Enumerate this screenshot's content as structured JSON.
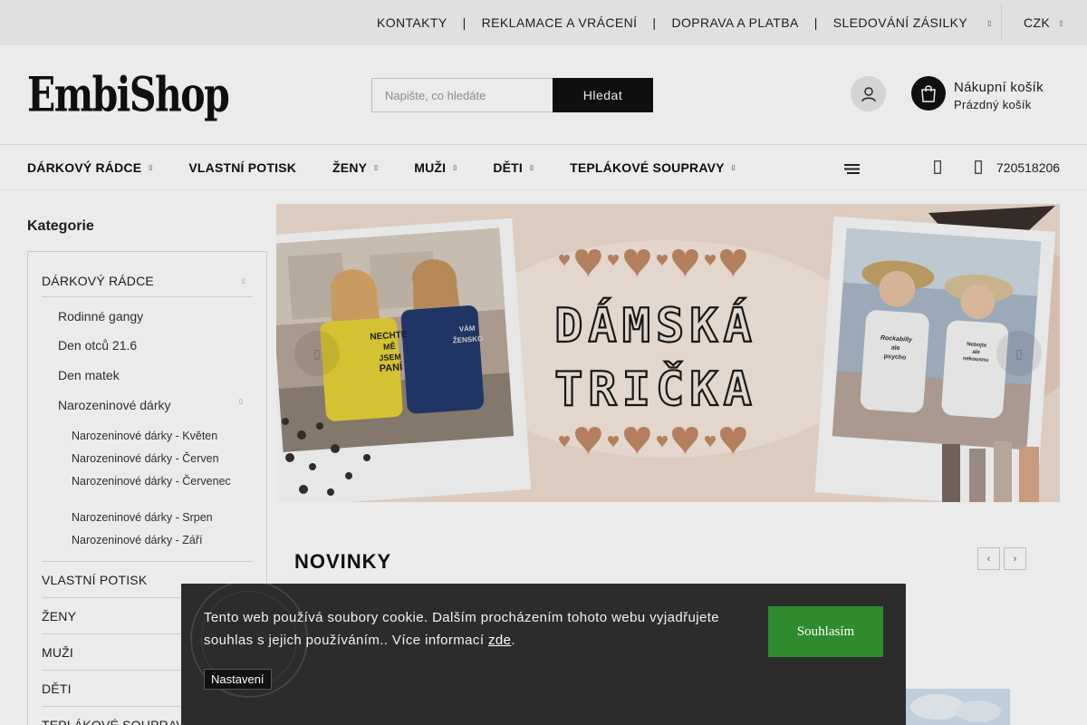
{
  "topbar": {
    "links": [
      "KONTAKTY",
      "REKLAMACE A VRÁCENÍ",
      "DOPRAVA A PLATBA",
      "SLEDOVÁNÍ ZÁSILKY"
    ],
    "separator": "|",
    "currency": "CZK"
  },
  "header": {
    "logo": "EmbiShop",
    "search_placeholder": "Napište, co hledáte",
    "search_button": "Hledat",
    "cart_title": "Nákupní košík",
    "cart_status": "Prázdný košík"
  },
  "nav": {
    "items": [
      {
        "label": "DÁRKOVÝ RÁDCE",
        "has_sub": true
      },
      {
        "label": "VLASTNÍ POTISK",
        "has_sub": false
      },
      {
        "label": "ŽENY",
        "has_sub": true
      },
      {
        "label": "MUŽI",
        "has_sub": true
      },
      {
        "label": "DĚTI",
        "has_sub": true
      },
      {
        "label": "TEPLÁKOVÉ SOUPRAVY",
        "has_sub": true
      }
    ],
    "phone": "720518206"
  },
  "sidebar": {
    "title": "Kategorie",
    "top": "DÁRKOVÝ RÁDCE",
    "sub": [
      "Rodinné gangy",
      "Den otců 21.6",
      "Den matek",
      "Narozeninové dárky"
    ],
    "sub2": [
      "Narozeninové dárky - Květen",
      "Narozeninové dárky - Červen",
      "Narozeninové dárky - Červenec",
      "Narozeninové dárky - Srpen",
      "Narozeninové dárky - Září"
    ],
    "main": [
      "VLASTNÍ POTISK",
      "ŽENY",
      "MUŽI",
      "DĚTI",
      "TEPLÁKOVÉ SOUPRAVY"
    ]
  },
  "banner": {
    "line1": "DÁMSKÁ",
    "line2": "TRIČKA",
    "shirt_left_1": "NECHTE",
    "shirt_left_2": "MĚ",
    "shirt_left_3": "JSEM",
    "shirt_left_4": "PANÍ",
    "shirt_mid_1": "VÁM",
    "shirt_mid_2": "ŽENSKO",
    "shirt_r1_1": "Rockabilly",
    "shirt_r1_2": "ale",
    "shirt_r1_3": "psycho",
    "shirt_r2_1": "Nebojte",
    "shirt_r2_2": "ale",
    "shirt_r2_3": "nekousnu"
  },
  "novinky": {
    "title": "NOVINKY"
  },
  "cookie": {
    "text": "Tento web používá soubory cookie. Dalším procházením tohoto webu vyjadřujete souhlas s jejich používáním.. Více informací",
    "link": "zde",
    "period": ".",
    "accept": "Souhlasím",
    "settings": "Nastavení"
  },
  "colors": {
    "accent": "#111111",
    "cookie_bg": "#2c2c2c",
    "accept_green": "#2e8b2e",
    "banner_bg": "#f0ddd0",
    "heart": "#c48a66"
  },
  "icons": [
    "user-icon",
    "cart-icon",
    "menu-icon",
    "mail-icon",
    "phone-icon",
    "chevron-left-icon",
    "chevron-right-icon"
  ]
}
